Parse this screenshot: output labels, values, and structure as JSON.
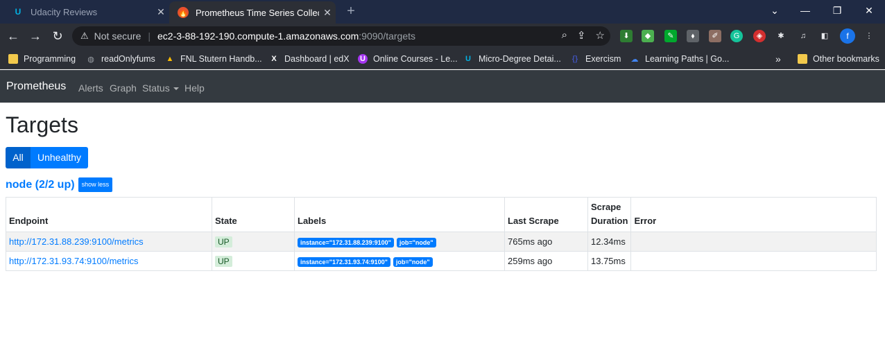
{
  "browser": {
    "tabs": [
      {
        "title": "Udacity Reviews",
        "active": false
      },
      {
        "title": "Prometheus Time Series Collecti",
        "active": true
      }
    ],
    "new_tab": "+",
    "address": {
      "security": "Not secure",
      "host": "ec2-3-88-192-190.compute-1.amazonaws.com",
      "rest": ":9090/targets"
    },
    "profile_initial": "f",
    "bookmarks": [
      {
        "label": "Programming",
        "icon": "folder-icon"
      },
      {
        "label": "readOnlyfums",
        "icon": "globe-icon"
      },
      {
        "label": "FNL Stutern Handb...",
        "icon": "drive-icon"
      },
      {
        "label": "Dashboard | edX",
        "icon": "edx-icon"
      },
      {
        "label": "Online Courses - Le...",
        "icon": "udemy-icon"
      },
      {
        "label": "Micro-Degree Detai...",
        "icon": "udacity-icon"
      },
      {
        "label": "Exercism",
        "icon": "exercism-icon"
      },
      {
        "label": "Learning Paths | Go...",
        "icon": "google-cloud-icon"
      }
    ],
    "bookmarks_more": "»",
    "other_bookmarks": "Other bookmarks"
  },
  "nav": {
    "brand": "Prometheus",
    "links": [
      "Alerts",
      "Graph",
      "Status",
      "Help"
    ]
  },
  "page": {
    "title": "Targets",
    "filter_all": "All",
    "filter_unhealthy": "Unhealthy",
    "job_title": "node (2/2 up)",
    "show_less": "show less"
  },
  "table": {
    "headers": [
      "Endpoint",
      "State",
      "Labels",
      "Last Scrape",
      "Scrape Duration",
      "Error"
    ],
    "rows": [
      {
        "endpoint": "http://172.31.88.239:9100/metrics",
        "state": "UP",
        "labels": [
          "instance=\"172.31.88.239:9100\"",
          "job=\"node\""
        ],
        "last_scrape": "765ms ago",
        "duration": "12.34ms",
        "error": ""
      },
      {
        "endpoint": "http://172.31.93.74:9100/metrics",
        "state": "UP",
        "labels": [
          "instance=\"172.31.93.74:9100\"",
          "job=\"node\""
        ],
        "last_scrape": "259ms ago",
        "duration": "13.75ms",
        "error": ""
      }
    ]
  }
}
